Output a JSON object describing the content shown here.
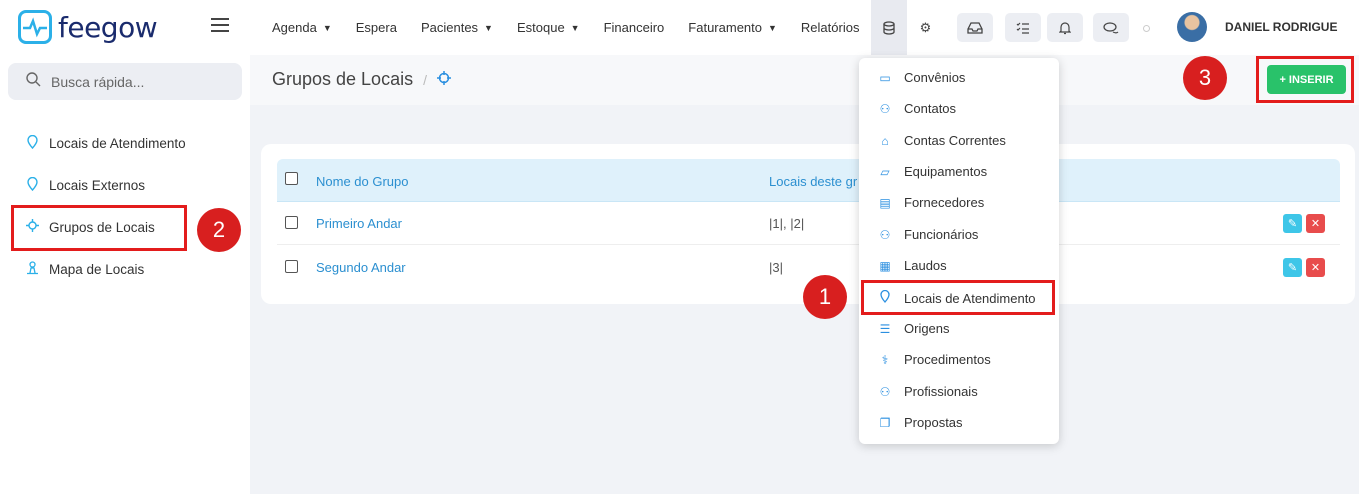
{
  "brand": {
    "name": "feegow",
    "color": "#2bb0e8"
  },
  "nav": {
    "items": [
      {
        "label": "Agenda",
        "caret": true
      },
      {
        "label": "Espera",
        "caret": false
      },
      {
        "label": "Pacientes",
        "caret": true
      },
      {
        "label": "Estoque",
        "caret": true
      },
      {
        "label": "Financeiro",
        "caret": false
      },
      {
        "label": "Faturamento",
        "caret": true
      },
      {
        "label": "Relatórios",
        "caret": false
      }
    ]
  },
  "user": {
    "name": "DANIEL RODRIGUE"
  },
  "sidebar": {
    "search_placeholder": "Busca rápida...",
    "items": [
      {
        "label": "Locais de Atendimento",
        "icon": "map-pin-icon"
      },
      {
        "label": "Locais Externos",
        "icon": "map-pin-icon"
      },
      {
        "label": "Grupos de Locais",
        "icon": "crosshair-icon"
      },
      {
        "label": "Mapa de Locais",
        "icon": "location-person-icon"
      }
    ]
  },
  "page": {
    "title": "Grupos de Locais",
    "insert_label": "+ INSERIR"
  },
  "table": {
    "columns": [
      "Nome do Grupo",
      "Locais deste gr"
    ],
    "rows": [
      {
        "name": "Primeiro Andar",
        "locais": "|1|, |2|"
      },
      {
        "name": "Segundo Andar",
        "locais": "|3|"
      }
    ]
  },
  "dropdown": {
    "items": [
      {
        "label": "Convênios",
        "icon": "card-icon"
      },
      {
        "label": "Contatos",
        "icon": "user-icon"
      },
      {
        "label": "Contas Correntes",
        "icon": "bank-icon"
      },
      {
        "label": "Equipamentos",
        "icon": "laptop-icon"
      },
      {
        "label": "Fornecedores",
        "icon": "archive-icon"
      },
      {
        "label": "Funcionários",
        "icon": "user-icon"
      },
      {
        "label": "Laudos",
        "icon": "document-icon"
      },
      {
        "label": "Locais de Atendimento",
        "icon": "map-pin-icon"
      },
      {
        "label": "Origens",
        "icon": "list-icon"
      },
      {
        "label": "Procedimentos",
        "icon": "stethoscope-icon"
      },
      {
        "label": "Profissionais",
        "icon": "doctor-icon"
      },
      {
        "label": "Propostas",
        "icon": "copy-icon"
      }
    ]
  },
  "annotations": {
    "step1": "1",
    "step2": "2",
    "step3": "3"
  },
  "colors": {
    "accent": "#2b8fd0",
    "insert_button": "#29c26a",
    "highlight": "#e31c1c"
  }
}
